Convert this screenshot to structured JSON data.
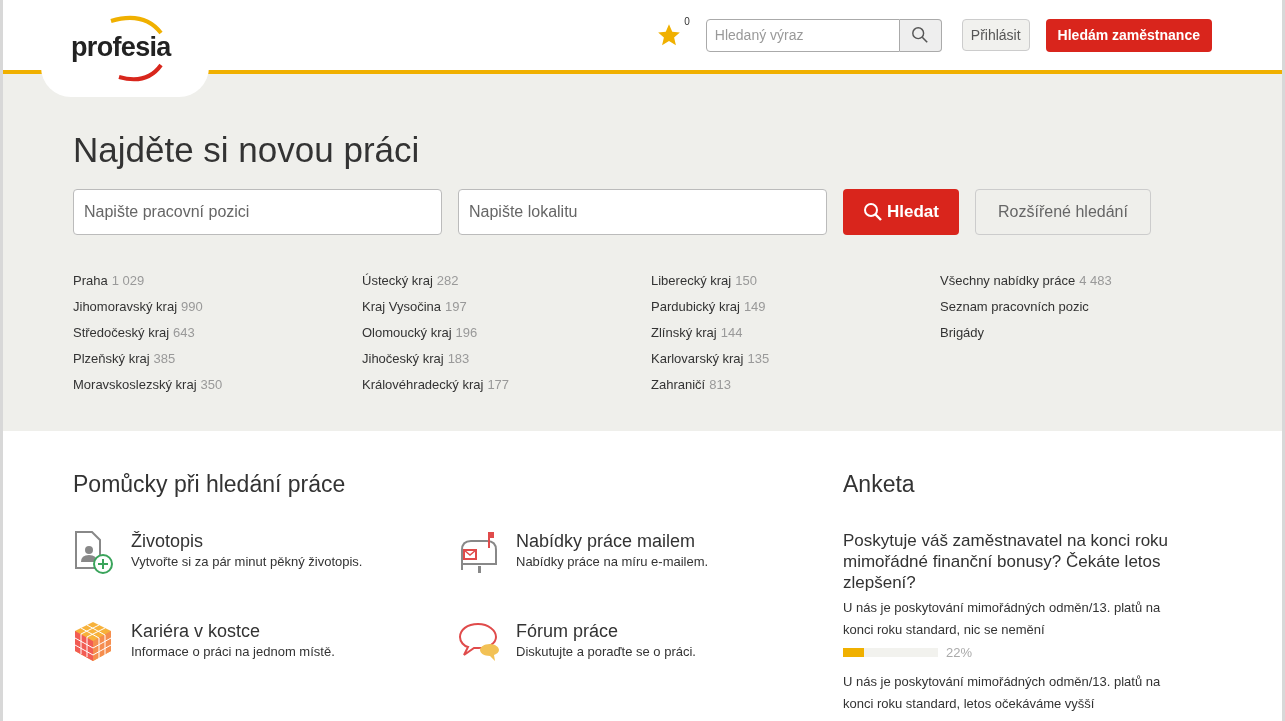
{
  "header": {
    "logo": "profesia",
    "favorites_count": "0",
    "search": {
      "placeholder": "Hledaný výraz"
    },
    "login": "Přihlásit",
    "employer_button": "Hledám zaměstnance"
  },
  "hero": {
    "title": "Najděte si novou práci",
    "position_field": {
      "placeholder": "Napište pracovní pozici"
    },
    "location_field": {
      "placeholder": "Napište lokalitu"
    },
    "search_button": "Hledat",
    "advanced_button": "Rozšířené hledání",
    "link_columns": [
      [
        {
          "label": "Praha",
          "count": "1 029"
        },
        {
          "label": "Jihomoravský kraj",
          "count": "990"
        },
        {
          "label": "Středočeský kraj",
          "count": "643"
        },
        {
          "label": "Plzeňský kraj",
          "count": "385"
        },
        {
          "label": "Moravskoslezský kraj",
          "count": "350"
        }
      ],
      [
        {
          "label": "Ústecký kraj",
          "count": "282"
        },
        {
          "label": "Kraj Vysočina",
          "count": "197"
        },
        {
          "label": "Olomoucký kraj",
          "count": "196"
        },
        {
          "label": "Jihočeský kraj",
          "count": "183"
        },
        {
          "label": "Královéhradecký kraj",
          "count": "177"
        }
      ],
      [
        {
          "label": "Liberecký kraj",
          "count": "150"
        },
        {
          "label": "Pardubický kraj",
          "count": "149"
        },
        {
          "label": "Zlínský kraj",
          "count": "144"
        },
        {
          "label": "Karlovarský kraj",
          "count": "135"
        },
        {
          "label": "Zahraničí",
          "count": "813"
        }
      ],
      [
        {
          "label": "Všechny nabídky práce",
          "count": "4 483"
        },
        {
          "label": "Seznam pracovních pozic"
        },
        {
          "label": "Brigády"
        }
      ]
    ]
  },
  "tools": {
    "title": "Pomůcky při hledání práce",
    "items": [
      {
        "kind": "cv",
        "title": "Životopis",
        "text": "Vytvořte si za pár minut pěkný životopis."
      },
      {
        "kind": "mail",
        "title": "Nabídky práce mailem",
        "text": "Nabídky práce na míru e-mailem."
      },
      {
        "kind": "cube",
        "title": "Kariéra v kostce",
        "text": "Informace o práci na jednom místě."
      },
      {
        "kind": "forum",
        "title": "Fórum práce",
        "text": "Diskutujte a poraďte se o práci."
      }
    ]
  },
  "poll": {
    "title": "Anketa",
    "question": "Poskytuje váš zaměstnavatel na konci roku mimořádné finanční bonusy? Čekáte letos zlepšení?",
    "answers": [
      {
        "text": "U nás je poskytování mimořádných odměn/13. platů na konci roku standard, nic se nemění",
        "level": 0.22,
        "percent": "22%"
      },
      {
        "text": "U nás je poskytování mimořádných odměn/13. platů na konci roku standard, letos očekáváme vyšší"
      }
    ]
  }
}
